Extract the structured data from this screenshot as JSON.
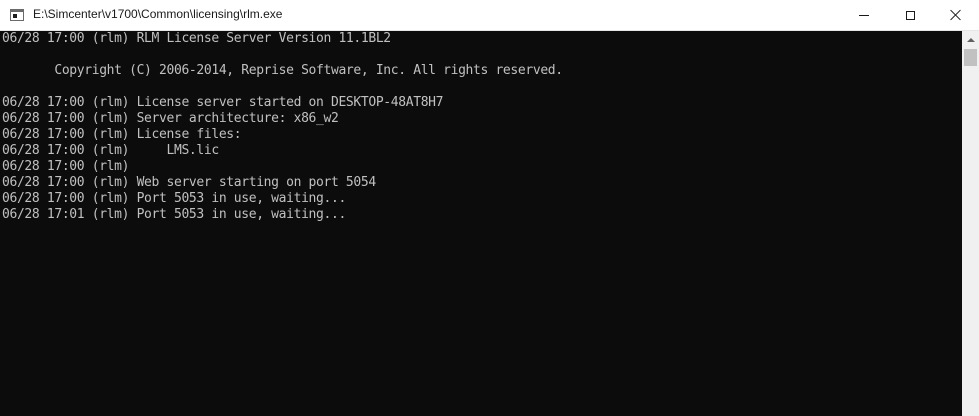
{
  "window": {
    "title": "E:\\Simcenter\\v1700\\Common\\licensing\\rlm.exe"
  },
  "icons": {
    "app": "console-window-icon",
    "minimize": "minimize-icon",
    "maximize": "maximize-icon",
    "close": "close-icon",
    "scroll_up": "arrow-up-icon"
  },
  "colors": {
    "console_bg": "#0c0c0c",
    "console_text": "#c0c0c0",
    "titlebar_bg": "#ffffff"
  },
  "console": {
    "lines": [
      "06/28 17:00 (rlm) RLM License Server Version 11.1BL2",
      "",
      "       Copyright (C) 2006-2014, Reprise Software, Inc. All rights reserved.",
      "",
      "06/28 17:00 (rlm) License server started on DESKTOP-48AT8H7",
      "06/28 17:00 (rlm) Server architecture: x86_w2",
      "06/28 17:00 (rlm) License files:",
      "06/28 17:00 (rlm)     LMS.lic",
      "06/28 17:00 (rlm)",
      "06/28 17:00 (rlm) Web server starting on port 5054",
      "06/28 17:00 (rlm) Port 5053 in use, waiting...",
      "06/28 17:01 (rlm) Port 5053 in use, waiting..."
    ]
  }
}
